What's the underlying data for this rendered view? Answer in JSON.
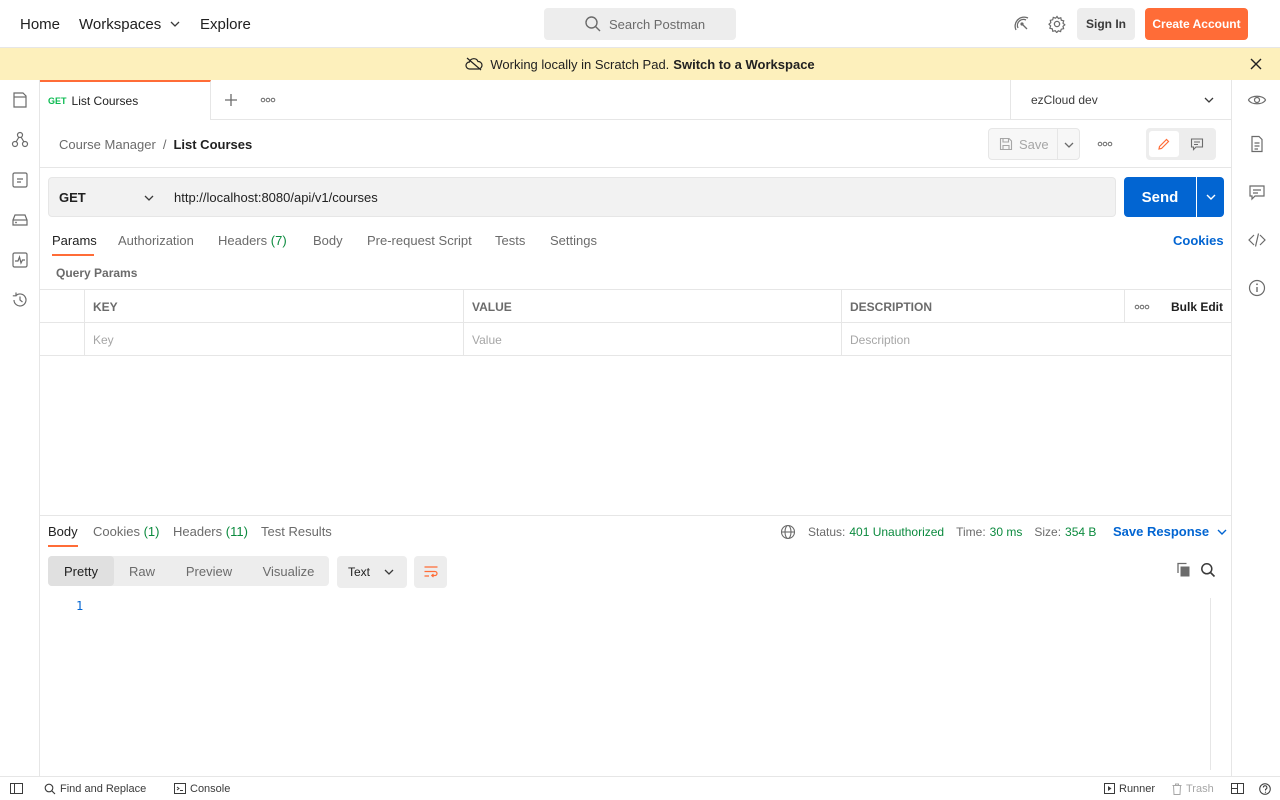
{
  "topbar": {
    "home": "Home",
    "workspaces": "Workspaces",
    "explore": "Explore",
    "search_placeholder": "Search Postman",
    "signin": "Sign In",
    "create_account": "Create Account"
  },
  "banner": {
    "text": "Working locally in Scratch Pad.",
    "link": "Switch to a Workspace"
  },
  "tab": {
    "method": "GET",
    "title": "List Courses"
  },
  "environment": "ezCloud dev",
  "breadcrumb": {
    "parent": "Course Manager",
    "sep": "/",
    "current": "List Courses"
  },
  "save_label": "Save",
  "request": {
    "method": "GET",
    "url": "http://localhost:8080/api/v1/courses",
    "send": "Send"
  },
  "req_tabs": {
    "params": "Params",
    "authorization": "Authorization",
    "headers": "Headers",
    "headers_count": "(7)",
    "body": "Body",
    "prerequest": "Pre-request Script",
    "tests": "Tests",
    "settings": "Settings",
    "cookies": "Cookies"
  },
  "query_params": {
    "title": "Query Params",
    "columns": [
      "KEY",
      "VALUE",
      "DESCRIPTION"
    ],
    "bulk_edit": "Bulk Edit",
    "placeholders": [
      "Key",
      "Value",
      "Description"
    ]
  },
  "response": {
    "tabs": {
      "body": "Body",
      "cookies": "Cookies",
      "cookies_count": "(1)",
      "headers": "Headers",
      "headers_count": "(11)",
      "test_results": "Test Results"
    },
    "status_label": "Status:",
    "status_value": "401 Unauthorized",
    "time_label": "Time:",
    "time_value": "30 ms",
    "size_label": "Size:",
    "size_value": "354 B",
    "save_response": "Save Response",
    "formats": [
      "Pretty",
      "Raw",
      "Preview",
      "Visualize"
    ],
    "type": "Text",
    "line_number": "1"
  },
  "footer": {
    "find_replace": "Find and Replace",
    "console": "Console",
    "runner": "Runner",
    "trash": "Trash"
  },
  "colors": {
    "accent": "#ff6c37",
    "primary": "#0265d2",
    "banner": "#fdf0bc",
    "success": "#0b8a3e"
  }
}
